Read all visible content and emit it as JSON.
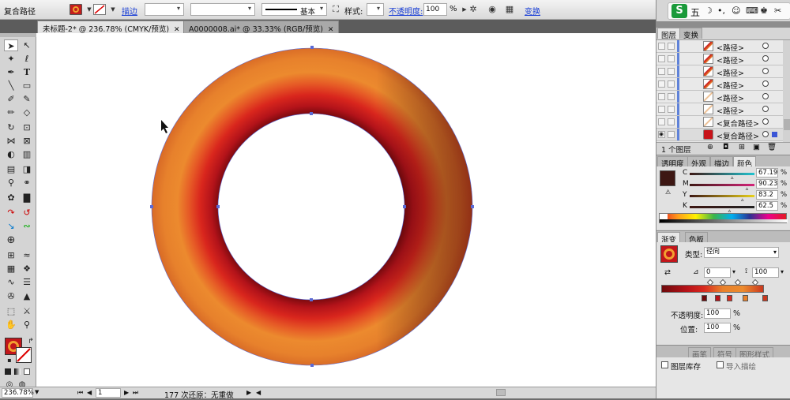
{
  "control_bar": {
    "object_type": "复合路径",
    "stroke_label": "描边",
    "stroke_style": "基本",
    "style_label": "样式:",
    "opacity_label": "不透明度:",
    "opacity_value": "100",
    "opacity_unit": "%",
    "transform_label": "变换",
    "fill_icon": "ring-swatch-icon",
    "stroke_icon": "none-stroke-icon"
  },
  "tabs": [
    {
      "label": "未标题-2* @ 236.78% (CMYK/预览)",
      "close": "✕"
    },
    {
      "label": "A0000008.ai* @ 33.33% (RGB/预览)",
      "close": "✕"
    }
  ],
  "status_bar": {
    "zoom": "236.78%",
    "page": "1",
    "history": "177 次还原：无重做"
  },
  "taskbar": {
    "app_badge": "S",
    "ime_char": "五"
  },
  "layers_panel": {
    "tabs": [
      "图层",
      "变换"
    ],
    "rows": [
      {
        "name": "<路径>"
      },
      {
        "name": "<路径>"
      },
      {
        "name": "<路径>"
      },
      {
        "name": "<路径>"
      },
      {
        "name": "<路径>"
      },
      {
        "name": "<路径>"
      },
      {
        "name": "<复合路径>"
      },
      {
        "name": "<复合路径>"
      }
    ],
    "footer": "1 个图层"
  },
  "color_panel": {
    "tabs": [
      "透明度",
      "外观",
      "描边",
      "颜色"
    ],
    "channels": [
      {
        "key": "C",
        "value": "67.19",
        "unit": "%",
        "color": "#21c4d0"
      },
      {
        "key": "M",
        "value": "90.23",
        "unit": "%",
        "color": "#d4257a"
      },
      {
        "key": "Y",
        "value": "83.2",
        "unit": "%",
        "color": "#e8d11a"
      },
      {
        "key": "K",
        "value": "62.5",
        "unit": "%",
        "color": "#222222"
      }
    ],
    "swatch_color": "#3d1713"
  },
  "gradient_panel": {
    "tabs": [
      "渐变",
      "色板"
    ],
    "type_label": "类型:",
    "type_value": "径向",
    "angle_value": "0",
    "ratio_value": "100",
    "opacity_label": "不透明度:",
    "opacity_value": "100",
    "location_label": "位置:",
    "location_value": "100",
    "unit": "%",
    "bottom_tabs": [
      "画笔",
      "符号",
      "图形样式"
    ],
    "checkbox_1": "图层库存",
    "checkbox_2": "导入描绘"
  },
  "colors": {
    "ring_outer": "#e8852a",
    "ring_dark": "#c4141a",
    "ring_deep": "#8a0d12",
    "selection": "#5b6ad4"
  }
}
